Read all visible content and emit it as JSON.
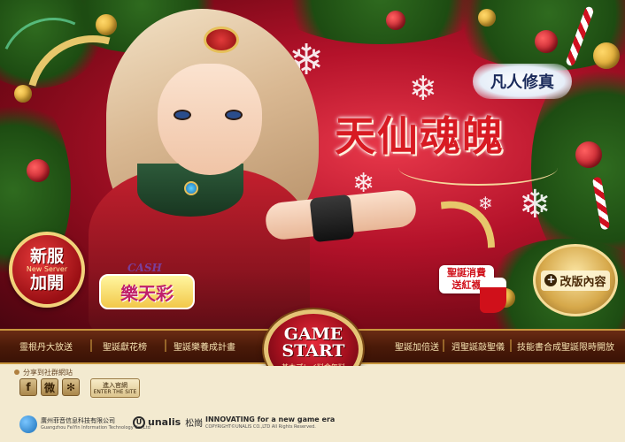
{
  "hero": {
    "game_logo": "凡人修真",
    "title": "天仙魂魄"
  },
  "badges": {
    "new_server_top": "新服",
    "new_server_en": "New Server",
    "new_server_bottom": "加開",
    "cash_word": "CASH",
    "cash_name": "樂天彩",
    "sock_text_1": "聖誕消費",
    "sock_text_2": "送紅襪",
    "update_label": "改版內容"
  },
  "nav": {
    "left": [
      "靈根丹大放送",
      "聖誕獻花榜",
      "聖誕樂養成計畫"
    ],
    "right": [
      "聖誕加倍送",
      "週聖誕敲聖儀",
      "技能書合成聖誕限時開放"
    ]
  },
  "start": {
    "line1": "GAME",
    "line2": "START",
    "sub": "基本プレイ料金無料"
  },
  "footer": {
    "share_label": "分享到社群網站",
    "social": [
      "f",
      "微",
      "✻"
    ],
    "enter_cn": "進入官網",
    "enter_en": "ENTER THE SITE",
    "publisher_cn": "廣州菲音信息科技有限公司",
    "publisher_en": "Guangzhou FeiYin Information Technology Co.,Ltd",
    "unalis_brand": "unalis",
    "unalis_cn": "松崗",
    "innovating": "INNOVATING for a new game era",
    "copyright": "COPYRIGHT©UNALIS CO.,LTD All Rights Reserved."
  }
}
